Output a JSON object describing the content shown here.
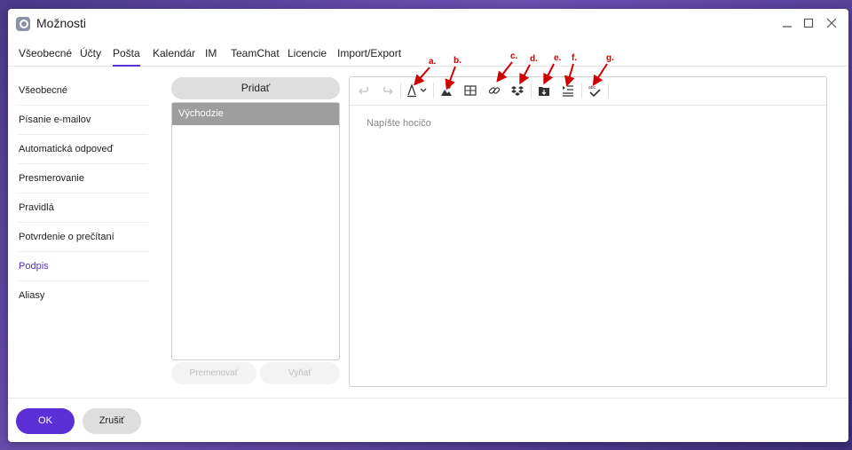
{
  "window": {
    "title": "Možnosti",
    "controls": [
      "minimize-icon",
      "maximize-icon",
      "close-icon"
    ]
  },
  "tabs": [
    {
      "label": "Všeobecné"
    },
    {
      "label": "Účty"
    },
    {
      "label": "Pošta",
      "active": true
    },
    {
      "label": "Kalendár"
    },
    {
      "label": "IM"
    },
    {
      "label": "TeamChat"
    },
    {
      "label": "Licencie"
    },
    {
      "label": "Import/Export"
    }
  ],
  "sidebar": {
    "items": [
      {
        "label": "Všeobecné"
      },
      {
        "label": "Písanie e-mailov"
      },
      {
        "label": "Automatická odpoveď"
      },
      {
        "label": "Presmerovanie"
      },
      {
        "label": "Pravidlá"
      },
      {
        "label": "Potvrdenie o prečítaní"
      },
      {
        "label": "Podpis",
        "active": true
      },
      {
        "label": "Aliasy"
      }
    ]
  },
  "signatures": {
    "add_label": "Pridať",
    "items": [
      {
        "label": "Východzie"
      }
    ],
    "rename_label": "Premenovať",
    "delete_label": "Vyňať"
  },
  "editor": {
    "placeholder": "Napíšte hocičo",
    "toolbar_icons": [
      "undo-icon",
      "redo-icon",
      "text-format-icon",
      "image-icon",
      "table-icon",
      "link-icon",
      "dropbox-icon",
      "insert-file-icon",
      "list-indent-icon",
      "spellcheck-icon"
    ]
  },
  "annotations": [
    "a.",
    "b.",
    "c.",
    "d.",
    "e.",
    "f.",
    "g."
  ],
  "footer": {
    "ok_label": "OK",
    "cancel_label": "Zrušiť"
  },
  "colors": {
    "accent": "#5b2fd6",
    "annotation": "#d00000",
    "list_selected": "#9e9e9e"
  }
}
